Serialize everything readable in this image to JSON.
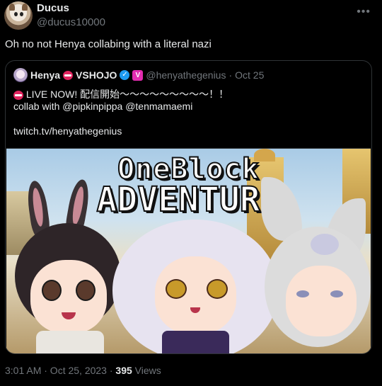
{
  "tweet": {
    "display_name": "Ducus",
    "handle": "@ducus10000",
    "text": "Oh no not Henya collabing with a literal nazi",
    "timestamp": "3:01 AM · Oct 25, 2023 ·",
    "views_count": "395",
    "views_label": "Views",
    "more_icon": "more-horizontal-icon"
  },
  "quote": {
    "display_name": "Henya",
    "name_suffix": "VSHOJO",
    "handle": "@henyathegenius",
    "separator": "·",
    "date": "Oct 25",
    "line1": "LIVE NOW! 配信開始〜〜〜〜〜〜〜〜〜！！",
    "line2": "collab with @pipkinpippa @tenmamaemi",
    "line3": "twitch.tv/henyathegenius",
    "badges": [
      "live-icon",
      "verified-icon",
      "vshojo-icon"
    ],
    "verified_glyph": "✓",
    "vshojo_glyph": "V"
  },
  "media": {
    "title_line1": "OneBlock",
    "title_line2": "ADVENTURE"
  },
  "colors": {
    "background": "#000000",
    "text_primary": "#e7e9ea",
    "text_secondary": "#71767b",
    "border": "#2f3336",
    "verified": "#1d9bf0",
    "vshojo": "#e32cb0",
    "live": "#e0245e"
  }
}
